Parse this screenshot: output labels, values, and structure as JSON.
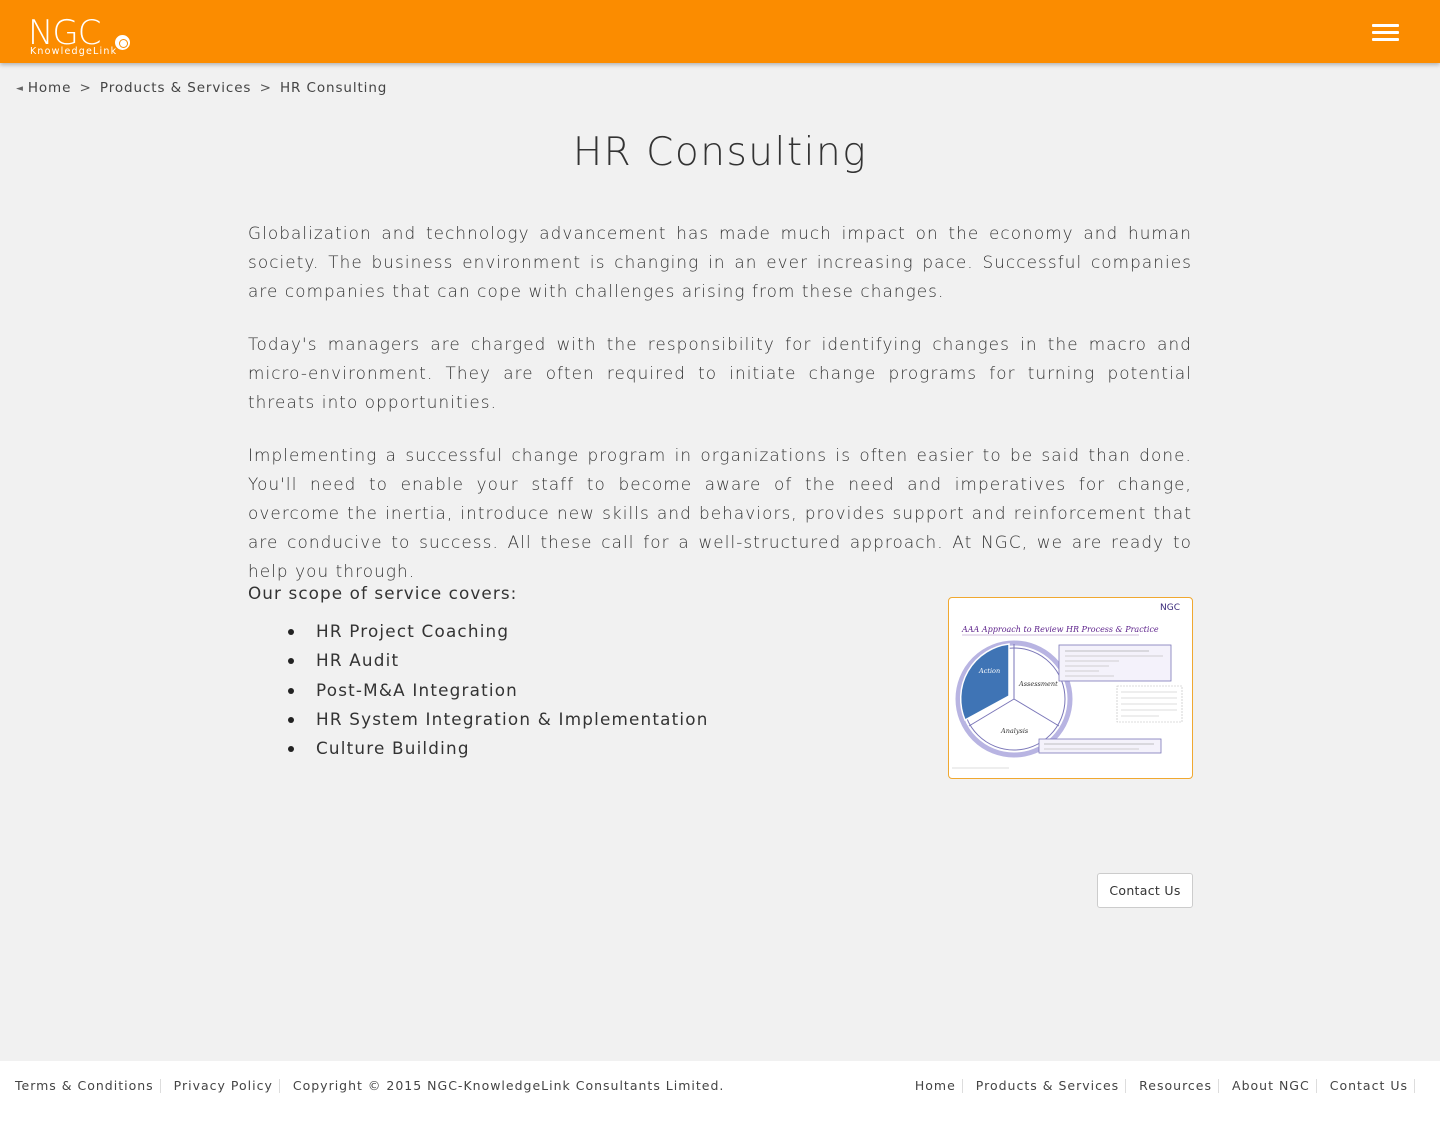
{
  "header": {
    "logo_text": "NGC",
    "logo_subtext": "KnowledgeLink",
    "menu_icon": "hamburger-menu-icon"
  },
  "breadcrumb": {
    "home_icon": "home-icon",
    "items": [
      "Home",
      "Products & Services",
      "HR Consulting"
    ],
    "separator": ">"
  },
  "page": {
    "title": "HR Consulting",
    "paragraphs": [
      "Globalization and technology advancement has made much impact on the economy and human society.  The business environment is changing in an ever increasing pace.  Successful companies are companies that can cope with challenges arising from these changes.",
      "Today's managers are charged with the responsibility for identifying changes in the macro and micro-environment.  They are often required to initiate change programs for turning potential threats into opportunities.",
      "Implementing a successful change program in organizations is often easier to be said than done.  You'll need to enable your staff to become aware of the need and imperatives for change, overcome the inertia, introduce new skills and behaviors, provides support and reinforcement that are conducive to success.  All these call for a well-structured approach.  At NGC, we are ready to help you through."
    ],
    "scope_intro": "Our scope of service covers:",
    "scope_items": [
      "HR Project Coaching",
      "HR Audit",
      "Post-M&A Integration",
      "HR System Integration & Implementation",
      "Culture Building"
    ],
    "diagram": {
      "brand": "NGC",
      "title": "AAA Approach to Review HR Process & Practice",
      "segments": [
        "Action",
        "Assessment",
        "Analysis"
      ]
    },
    "contact_button": "Contact Us"
  },
  "footer": {
    "left_links": [
      "Terms & Conditions",
      "Privacy Policy"
    ],
    "copyright": "Copyright © 2015 NGC-KnowledgeLink Consultants Limited.",
    "right_links": [
      "Home",
      "Products & Services",
      "Resources",
      "About NGC",
      "Contact Us"
    ]
  },
  "colors": {
    "header_bg": "#fb8c00",
    "page_bg": "#f1f1f1",
    "footer_bg": "#ffffff",
    "card_border": "#f0a830",
    "diagram_blue": "#3f74b5",
    "diagram_purple": "#8a84c8"
  }
}
